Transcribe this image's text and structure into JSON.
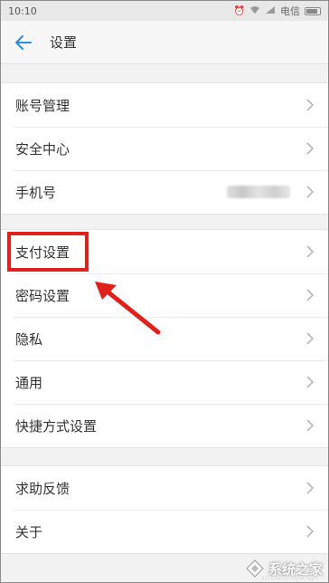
{
  "status_bar": {
    "time": "10:10",
    "carrier": "电信"
  },
  "header": {
    "title": "设置"
  },
  "groups": [
    {
      "items": [
        {
          "label": "账号管理"
        },
        {
          "label": "安全中心"
        },
        {
          "label": "手机号"
        }
      ]
    },
    {
      "items": [
        {
          "label": "支付设置"
        },
        {
          "label": "密码设置"
        },
        {
          "label": "隐私"
        },
        {
          "label": "通用"
        },
        {
          "label": "快捷方式设置"
        }
      ]
    },
    {
      "items": [
        {
          "label": "求助反馈"
        },
        {
          "label": "关于"
        }
      ]
    }
  ],
  "annotation": {
    "highlight_color": "#e0211b",
    "highlighted_item": "支付设置"
  },
  "watermark": {
    "text": "系统之家",
    "url": "XITONGZHIJIA.NET"
  }
}
